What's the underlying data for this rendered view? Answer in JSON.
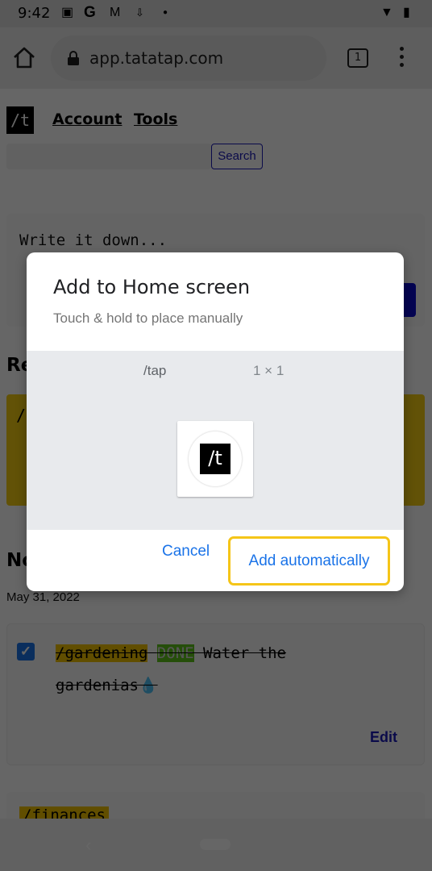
{
  "status_bar": {
    "time": "9:42",
    "icons": [
      "image-icon",
      "google-icon",
      "gmail-icon",
      "download-icon",
      "dot-icon"
    ],
    "right_icons": [
      "wifi-icon",
      "battery-icon"
    ]
  },
  "browser": {
    "url": "app.tatatap.com",
    "tab_count": "1"
  },
  "page": {
    "logo": "/t",
    "nav": [
      {
        "label": "Account"
      },
      {
        "label": "Tools"
      }
    ],
    "search": {
      "value": "",
      "placeholder": "",
      "button_label": "Search"
    },
    "compose": {
      "placeholder": "Write it down..."
    },
    "section_1_heading": "Re",
    "pinned_card_text": "/",
    "section_2_heading": "No",
    "date": "May 31, 2022",
    "notes": [
      {
        "checked": true,
        "tag": "/gardening",
        "status": "DONE",
        "text": " Water the gardenias",
        "emoji": "💧",
        "edit_label": "Edit"
      },
      {
        "tag": "/finances"
      }
    ],
    "colors": {
      "tag_yellow": "#f2c200",
      "done_green": "#5cc41a",
      "link_blue": "#1a1ab8"
    }
  },
  "dialog": {
    "title": "Add to Home screen",
    "subtitle": "Touch & hold to place manually",
    "preview_name": "/tap",
    "preview_size": "1 × 1",
    "icon_text": "/t",
    "cancel_label": "Cancel",
    "add_label": "Add automatically",
    "accent": "#1a73e8",
    "focus_ring": "#f5c518"
  },
  "nav_bar": {
    "back_glyph": "‹"
  }
}
